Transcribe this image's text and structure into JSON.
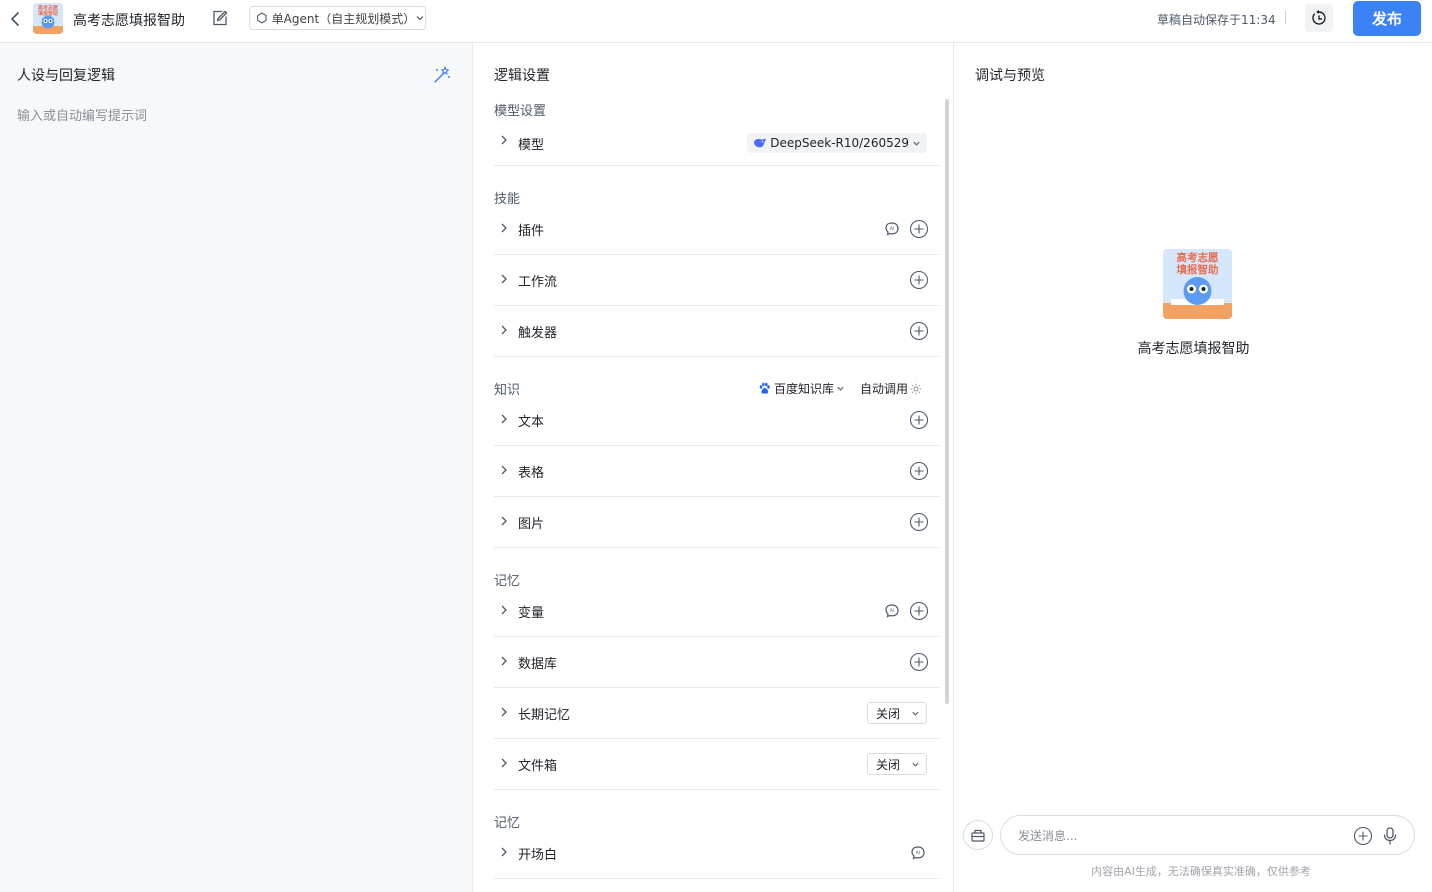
{
  "topbar": {
    "app_name": "高考志愿填报智助",
    "mode": "单Agent（自主规划模式）",
    "autosave": "草稿自动保存于11:34",
    "publish": "发布",
    "icon_text_line1": "高考志愿",
    "icon_text_line2": "填报智助"
  },
  "left": {
    "title": "人设与回复逻辑",
    "placeholder": "输入或自动编写提示词"
  },
  "mid": {
    "title": "逻辑设置",
    "model_section": "模型设置",
    "model_row": "模型",
    "model_value": "DeepSeek-R10/260529",
    "skills_section": "技能",
    "skills": [
      "插件",
      "工作流",
      "触发器"
    ],
    "knowledge_section": "知识",
    "kb_selector": "百度知识库",
    "auto_call": "自动调用",
    "knowledge": [
      "文本",
      "表格",
      "图片"
    ],
    "memory_section": "记忆",
    "memory": [
      "变量",
      "数据库",
      "长期记忆",
      "文件箱"
    ],
    "switch_off": "关闭",
    "memory_section_2": "记忆",
    "opening_row": "开场白"
  },
  "right": {
    "title": "调试与预览",
    "agent_name": "高考志愿填报智助",
    "input_placeholder": "发送消息...",
    "disclaimer": "内容由AI生成，无法确保真实准确，仅供参考"
  },
  "icons": {
    "back": "chevron-left-icon",
    "edit": "edit-icon",
    "history": "history-icon",
    "magic": "magic-wand-icon",
    "plus": "plus-circle-icon",
    "ai": "ai-generate-icon",
    "clear": "clear-chat-icon",
    "mic": "microphone-icon"
  },
  "colors": {
    "accent": "#3b82f6",
    "left_bg": "#f7f8fa",
    "border": "#e6e8eb"
  }
}
